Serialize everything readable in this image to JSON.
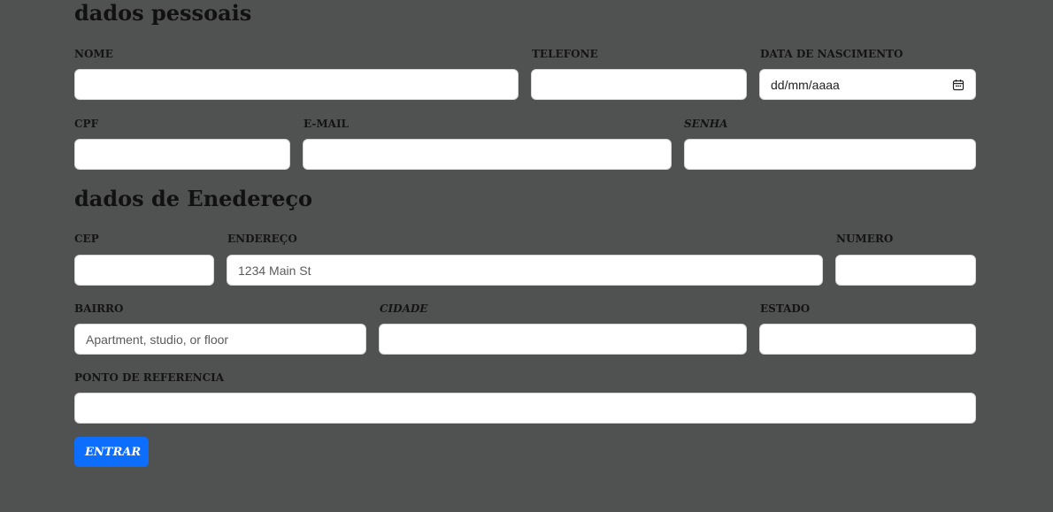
{
  "personal": {
    "heading": "dados pessoais",
    "nome_label": "NOME",
    "telefone_label": "TELEFONE",
    "nascimento_label": "DATA DE NASCIMENTO",
    "nascimento_placeholder": "dd/mm/aaaa",
    "cpf_label": "CPF",
    "email_label": "E-MAIL",
    "senha_label": "SENHA"
  },
  "address": {
    "heading": "dados de Enedereço",
    "cep_label": "CEP",
    "endereco_label": "ENDEREÇO",
    "endereco_placeholder": "1234 Main St",
    "numero_label": "NUMERO",
    "bairro_label": "BAIRRO",
    "bairro_placeholder": "Apartment, studio, or floor",
    "cidade_label": "CIDADE",
    "estado_label": "ESTADO",
    "referencia_label": "PONTO DE REFERENCIA"
  },
  "submit_label": "ENTRAR",
  "icons": {
    "calendar": "calendar-icon"
  },
  "colors": {
    "background": "#505151",
    "primary": "#0d6efd"
  }
}
